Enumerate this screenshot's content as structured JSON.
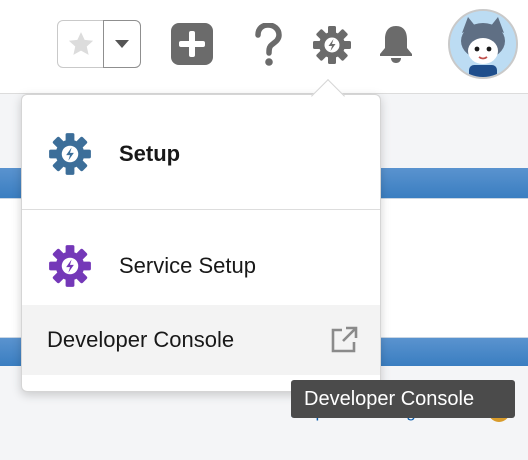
{
  "header": {
    "favorites_star_icon": "star-icon",
    "favorites_dropdown_icon": "chevron-down-icon",
    "global_actions_icon": "plus-icon",
    "help_icon": "question-mark-icon",
    "setup_icon": "gear-icon",
    "notifications_icon": "bell-icon",
    "avatar_icon": "user-avatar"
  },
  "setup_menu": {
    "items": [
      {
        "label": "Setup",
        "icon": "setup-gear-icon",
        "icon_color": "#3c6e99"
      },
      {
        "label": "Service Setup",
        "icon": "service-setup-gear-icon",
        "icon_color": "#7438b8"
      },
      {
        "label": "Developer Console",
        "icon": "external-link-icon"
      }
    ]
  },
  "page": {
    "help_link": "Help for this Page"
  },
  "tooltip": {
    "text": "Developer Console"
  },
  "colors": {
    "menu_hover_bg": "#f3f3f3",
    "tooltip_bg": "#4b4b4b",
    "band_blue": "#3b80c4",
    "header_icon_gray": "#6b6b6b"
  }
}
